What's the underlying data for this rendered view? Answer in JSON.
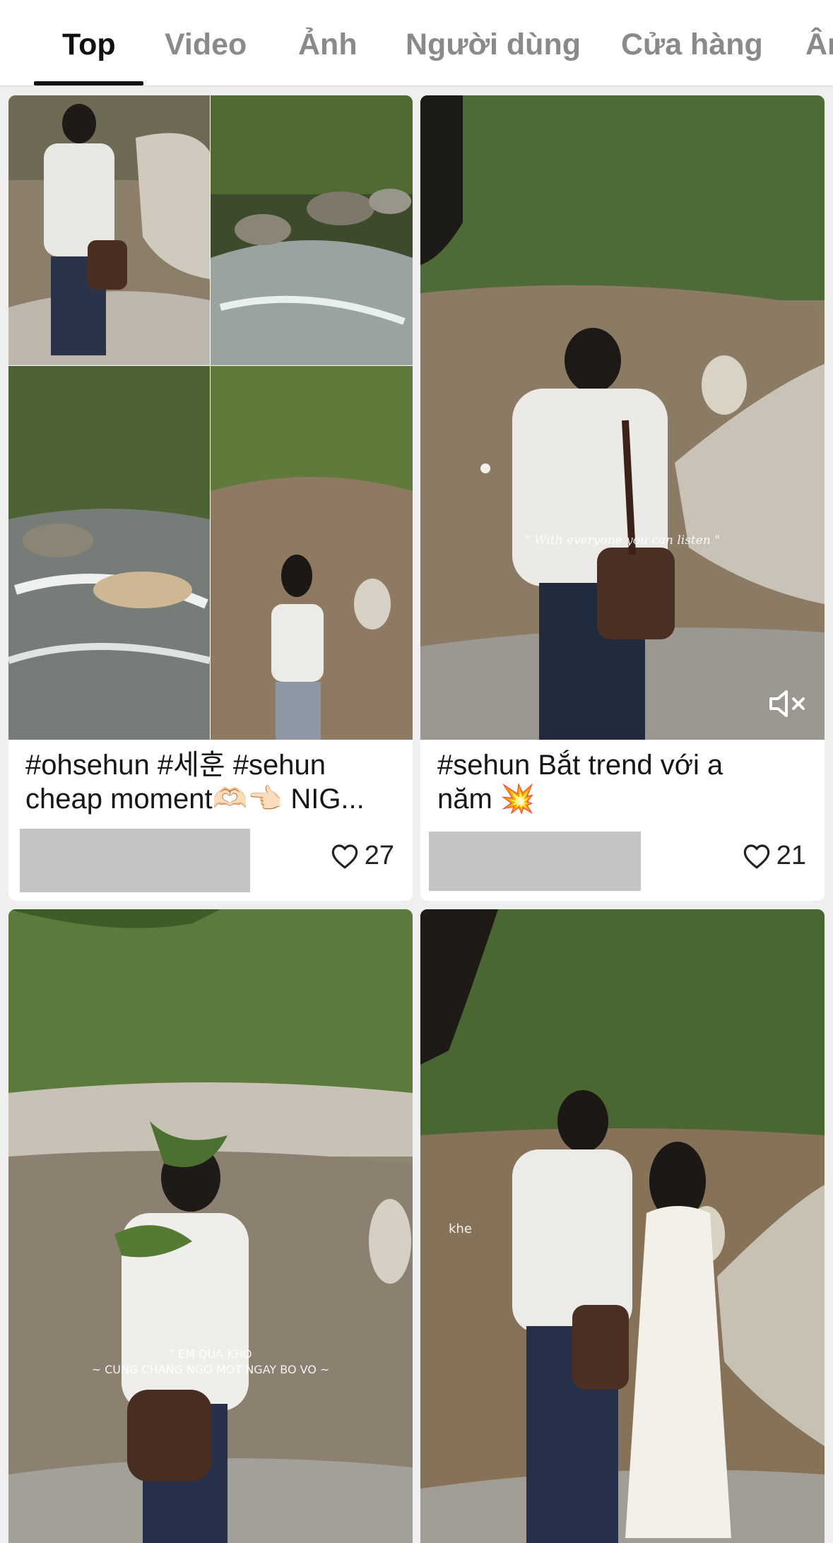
{
  "tabs": {
    "items": [
      "Top",
      "Video",
      "Ảnh",
      "Người dùng",
      "Cửa hàng",
      "Âm"
    ],
    "active_index": 0
  },
  "results": [
    {
      "caption": "#ohsehun #세훈 #sehun\ncheap moment🫶🏻👈🏻 NIG...",
      "likes": "27"
    },
    {
      "caption": "#sehun Bắt trend với a\nnăm 💥",
      "likes": "21",
      "overlay_text": "\" With everyone you can listen \"",
      "muted_icon": "speaker-muted-icon"
    },
    {
      "overlay_text_line1": "\" EM QUA KHO",
      "overlay_text_line2": "~ CUNG CHANG NGO MOT NGAY BO VO ~"
    },
    {
      "overlay_text": "khe"
    }
  ],
  "icons": {
    "like": "heart-outline-icon"
  },
  "colors": {
    "active_tab": "#111111",
    "inactive_tab": "#8a8a8a",
    "background": "#efefef"
  }
}
